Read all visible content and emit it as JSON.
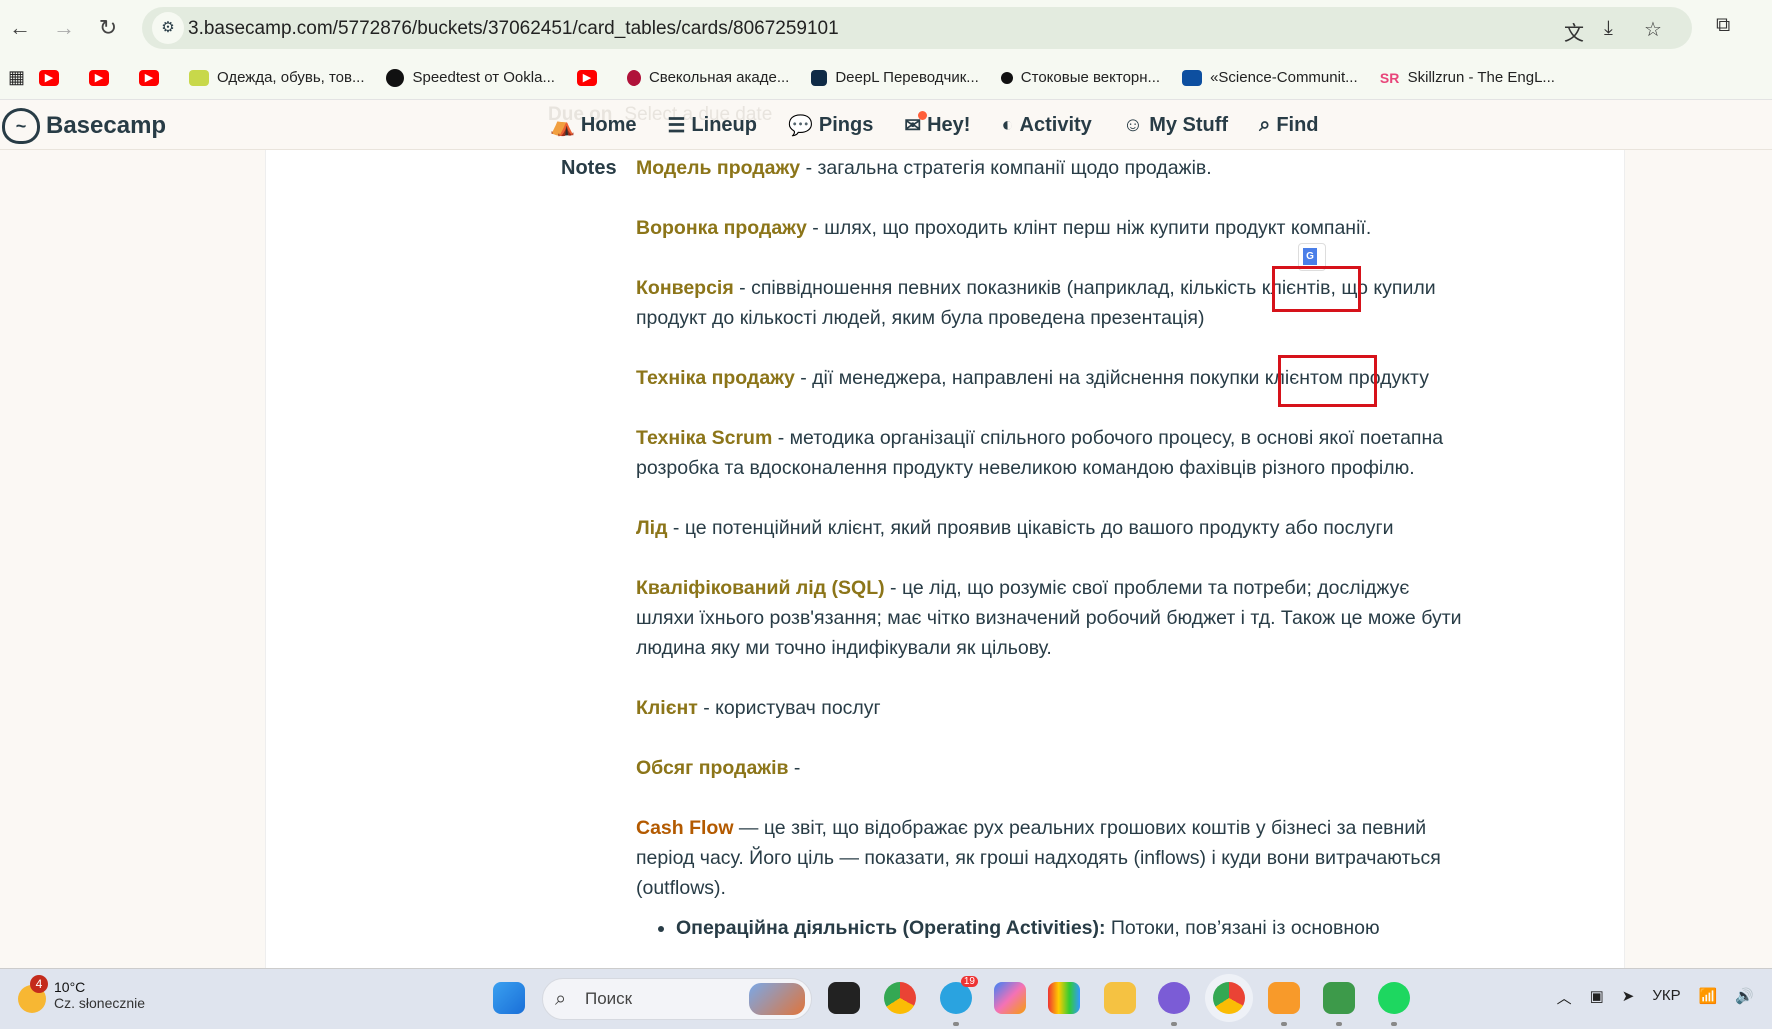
{
  "browser": {
    "url": "3.basecamp.com/5772876/buckets/37062451/card_tables/cards/8067259101",
    "nav_icons": [
      "back-icon",
      "forward-icon",
      "reload-icon"
    ],
    "right_icons": [
      "translate-icon",
      "install-app-icon",
      "bookmark-star-icon",
      "extensions-icon"
    ]
  },
  "bookmarks": [
    {
      "icon": "youtube-icon",
      "label": ""
    },
    {
      "icon": "youtube-icon",
      "label": ""
    },
    {
      "icon": "youtube-icon",
      "label": ""
    },
    {
      "icon": "shop-icon",
      "label": "Одежда, обувь, тов..."
    },
    {
      "icon": "speedtest-icon",
      "label": "Speedtest от Ookla..."
    },
    {
      "icon": "youtube-icon",
      "label": ""
    },
    {
      "icon": "beet-icon",
      "label": "Свекольная акаде..."
    },
    {
      "icon": "deepl-icon",
      "label": "DeepL Переводчик..."
    },
    {
      "icon": "stock-icon",
      "label": "Стоковые векторн..."
    },
    {
      "icon": "science-icon",
      "label": "«Science-Communit..."
    },
    {
      "icon": "skillzrun-icon",
      "label": "Skillzrun - The EngL..."
    }
  ],
  "header": {
    "logo": "Basecamp",
    "due_label": "Due on",
    "due_placeholder": "Select a due date",
    "nav": [
      {
        "icon": "home-icon",
        "label": "Home"
      },
      {
        "icon": "lineup-icon",
        "label": "Lineup"
      },
      {
        "icon": "pings-icon",
        "label": "Pings"
      },
      {
        "icon": "hey-icon",
        "label": "Hey!"
      },
      {
        "icon": "activity-icon",
        "label": "Activity"
      },
      {
        "icon": "my-stuff-icon",
        "label": "My Stuff"
      },
      {
        "icon": "find-icon",
        "label": "Find"
      }
    ]
  },
  "notes": {
    "label": "Notes",
    "entries": [
      {
        "term": "Модель продажу",
        "text": " -  загальна стратегія компанії щодо продажів."
      },
      {
        "term": "Воронка продажу",
        "text": " - шлях, що проходить клінт перш ніж купити продукт компанії."
      },
      {
        "term": "Конверсія",
        "text": " - співвідношення певних показників (наприклад, кількість клієнтів, що купили продукт до кількості людей, яким була проведена презентація)"
      },
      {
        "term": "Техніка продажу",
        "text": " - дії менеджера, направлені на здійснення покупки клієнтом продукту"
      },
      {
        "term": "Техніка Scrum",
        "text": " - методика організації спільного робочого процесу, в основі якої поетапна розробка та вдосконалення продукту невеликою командою фахівців різного профілю."
      },
      {
        "term": "Лід",
        "text": " - це потенційний клієнт, який проявив цікавість до вашого продукту або послуги"
      },
      {
        "term": "Кваліфікований лід (SQL)",
        "text": " - це лід, що розуміє свої проблеми та потреби; досліджує шляхи їхнього розв'язання; має чітко визначений робочий бюджет і тд. Також це може бути людина яку ми точно індифікували як цільову."
      },
      {
        "term": "Клієнт",
        "text": " - користувач послуг"
      },
      {
        "term": "Обсяг продажів",
        "text": " -"
      },
      {
        "term": "Cash Flow",
        "text": " — це звіт, що відображає рух реальних грошових коштів у бізнесі за певний період часу. Його ціль — показати, як гроші надходять (inflows) і куди вони витрачаються (outflows)."
      }
    ],
    "bullet": {
      "label": "Операційна діяльність (Operating Activities):",
      "text": " Потоки, пов’язані із основною"
    },
    "colors": {
      "term": "#8c7519",
      "cash_flow": "#b35a00",
      "highlight_box": "#d6121a"
    }
  },
  "taskbar": {
    "weather_badge": "4",
    "temperature": "10°C",
    "weather": "Cz. słonecznie",
    "search_placeholder": "Поиск",
    "telegram_badge": "19",
    "apps": [
      "task-view-icon",
      "chrome-icon",
      "telegram-icon",
      "copilot-icon",
      "paint-icon",
      "file-explorer-icon",
      "viber-icon",
      "chrome-active-icon",
      "sublime-icon",
      "app-icon",
      "spotify-icon"
    ],
    "language": "УКР"
  }
}
